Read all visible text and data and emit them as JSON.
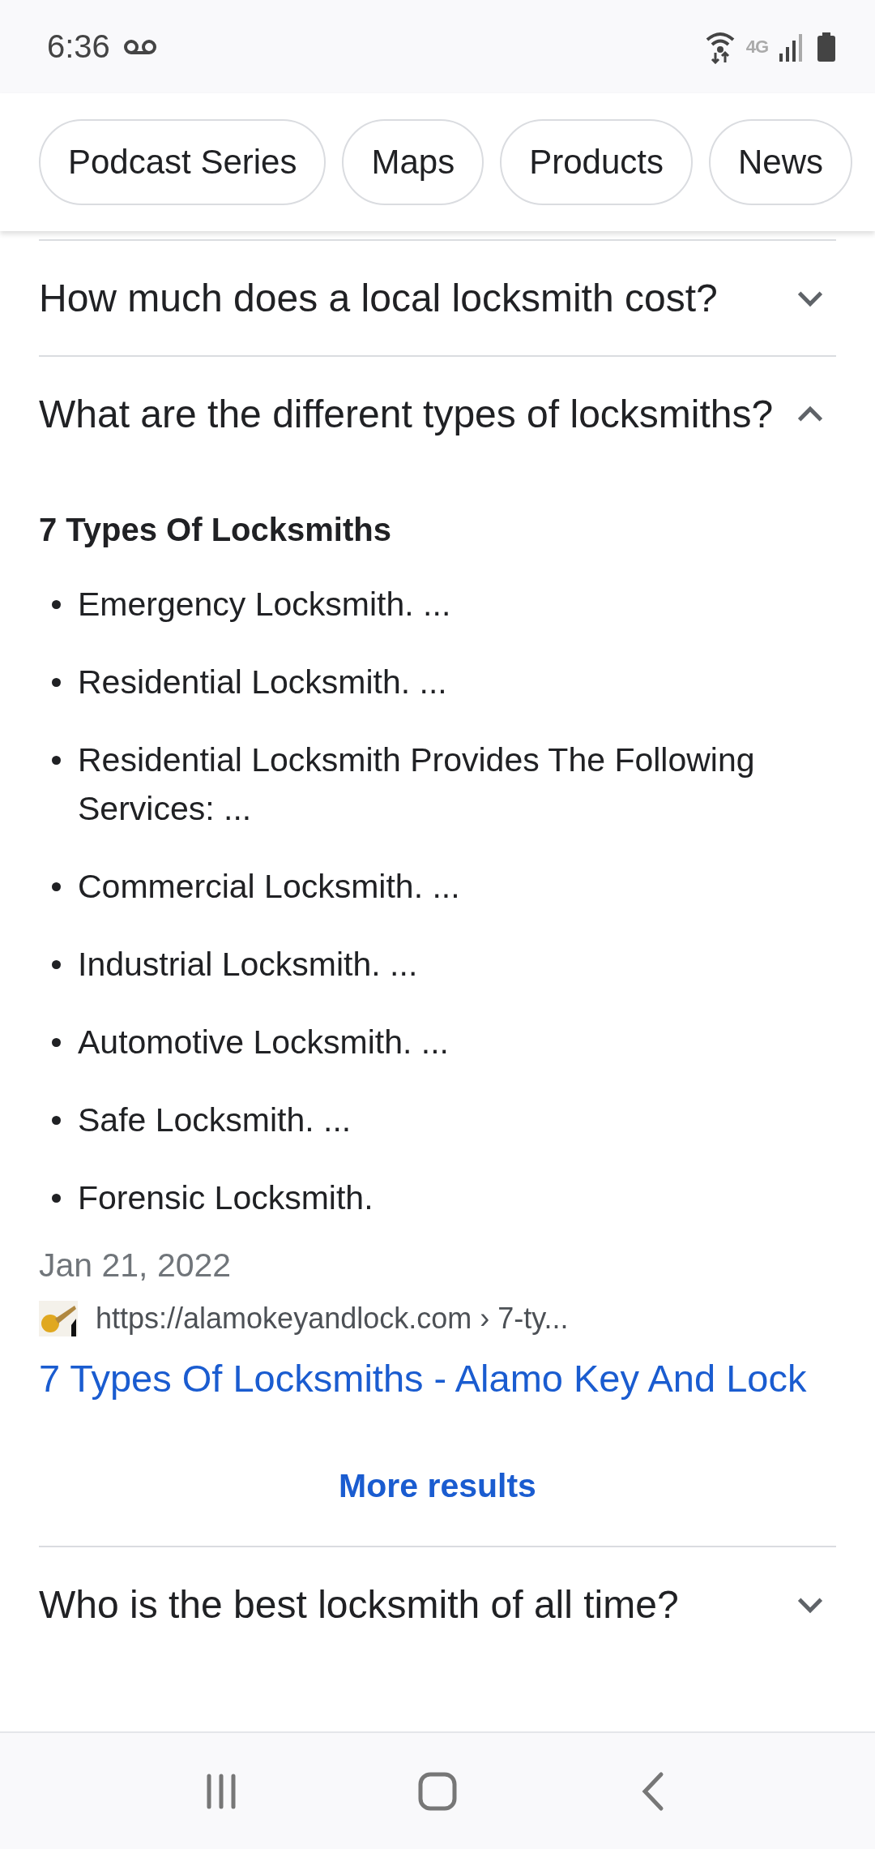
{
  "status_bar": {
    "time": "6:36",
    "network": "4G"
  },
  "chips": [
    {
      "label": "Podcast Series"
    },
    {
      "label": "Maps"
    },
    {
      "label": "Products"
    },
    {
      "label": "News"
    }
  ],
  "questions": [
    {
      "question": "How much does a local locksmith cost?",
      "expanded": false
    },
    {
      "question": "What are the different types of locksmiths?",
      "expanded": true,
      "answer": {
        "heading": "7 Types Of Locksmiths",
        "items": [
          "Emergency Locksmith. ...",
          "Residential Locksmith. ...",
          "Residential Locksmith Provides The Following Services: ...",
          "Commercial Locksmith. ...",
          "Industrial Locksmith. ...",
          "Automotive Locksmith. ...",
          "Safe Locksmith. ...",
          "Forensic Locksmith."
        ],
        "date": "Jan 21, 2022",
        "url": "https://alamokeyandlock.com › 7-ty...",
        "link": "7 Types Of Locksmiths - Alamo Key And Lock",
        "more": "More results"
      }
    },
    {
      "question": "Who is the best locksmith of all time?",
      "expanded": false
    }
  ]
}
